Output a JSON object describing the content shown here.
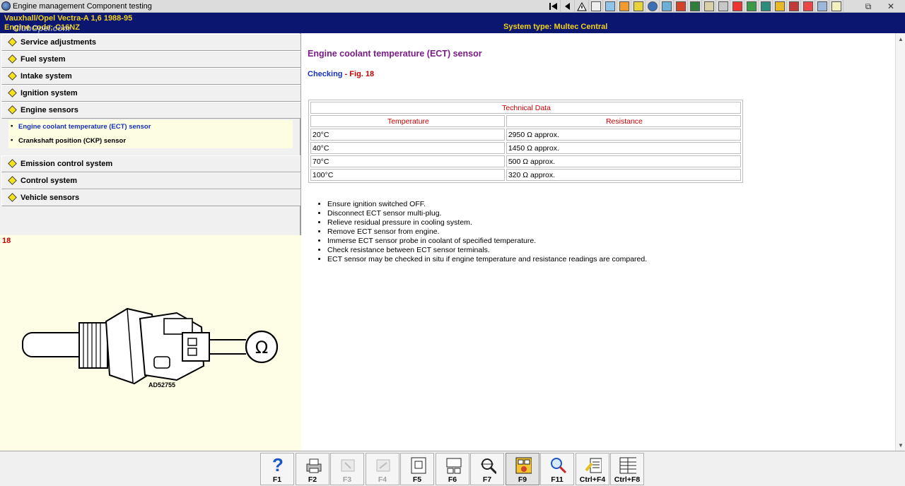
{
  "window": {
    "title": "Engine management Component testing",
    "controls": {
      "restore": "⧉",
      "close": "✕"
    }
  },
  "toolbar": {
    "icons": [
      "first-page-icon",
      "prev-page-icon",
      "warning-icon",
      "document-icon",
      "chart-icon",
      "palette-icon",
      "gear-icon",
      "circle-icon",
      "tool-icon",
      "chart2-icon",
      "battery-icon",
      "wrench-icon",
      "car-icon",
      "car2-icon",
      "car3-icon",
      "car4-icon",
      "car5-icon",
      "bulb-icon",
      "warning2-icon",
      "car6-icon",
      "document2-icon"
    ]
  },
  "header": {
    "vehicle": "Vauxhall/Opel   Vectra-A  1,6  1988-95",
    "engine": "Engine code: C16NZ",
    "system_type": "System type: Multec Central",
    "watermark": "ClubOpel.com"
  },
  "nav": {
    "items": [
      {
        "label": "Service adjustments"
      },
      {
        "label": "Fuel system"
      },
      {
        "label": "Intake system"
      },
      {
        "label": "Ignition system"
      },
      {
        "label": "Engine sensors"
      },
      {
        "label": "Emission control system"
      },
      {
        "label": "Control system"
      },
      {
        "label": "Vehicle sensors"
      }
    ],
    "subitems": [
      {
        "label": "Engine coolant temperature (ECT) sensor"
      },
      {
        "label": "Crankshaft position (CKP) sensor"
      }
    ]
  },
  "figure": {
    "number": "18",
    "code": "AD52755",
    "ohm_symbol": "Ω"
  },
  "content": {
    "title": "Engine coolant temperature (ECT) sensor",
    "checking_label": "Checking",
    "checking_sep": " - ",
    "figure_ref": "Fig. 18",
    "table": {
      "caption": "Technical Data",
      "headers": [
        "Temperature",
        "Resistance"
      ],
      "rows": [
        [
          "20°C",
          "2950 Ω approx."
        ],
        [
          "40°C",
          "1450 Ω approx."
        ],
        [
          "70°C",
          "500 Ω approx."
        ],
        [
          "100°C",
          "320 Ω approx."
        ]
      ]
    },
    "steps": [
      "Ensure ignition switched OFF.",
      "Disconnect ECT sensor multi-plug.",
      "Relieve residual pressure in cooling system.",
      "Remove ECT sensor from engine.",
      "Immerse ECT sensor probe in coolant of specified temperature.",
      "Check resistance between ECT sensor terminals.",
      "ECT sensor may be checked in situ if engine temperature and resistance readings are compared."
    ]
  },
  "function_keys": [
    {
      "label": "F1",
      "icon": "help-icon"
    },
    {
      "label": "F2",
      "icon": "printer-icon"
    },
    {
      "label": "F3",
      "icon": "disabled-tool-icon"
    },
    {
      "label": "F4",
      "icon": "disabled-tool2-icon"
    },
    {
      "label": "F5",
      "icon": "diagram-icon"
    },
    {
      "label": "F6",
      "icon": "connector-icon"
    },
    {
      "label": "F7",
      "icon": "search-tool-icon"
    },
    {
      "label": "F9",
      "icon": "component-icon"
    },
    {
      "label": "F11",
      "icon": "magnify-icon"
    },
    {
      "label": "Ctrl+F4",
      "icon": "notes-icon"
    },
    {
      "label": "Ctrl+F8",
      "icon": "table-icon"
    }
  ]
}
